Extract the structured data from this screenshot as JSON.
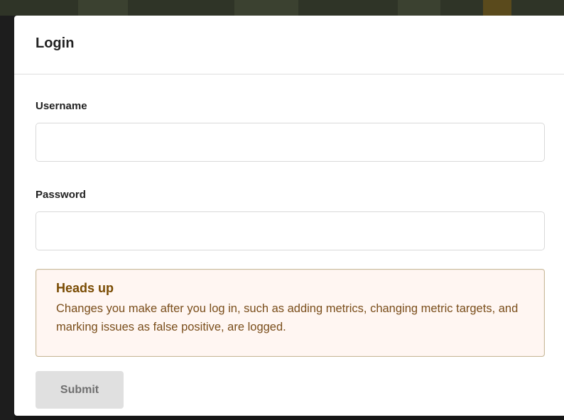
{
  "modal": {
    "title": "Login"
  },
  "form": {
    "username_label": "Username",
    "username_value": "",
    "password_label": "Password",
    "password_value": "",
    "submit_label": "Submit"
  },
  "notice": {
    "title": "Heads up",
    "text": "Changes you make after you log in, such as adding metrics, changing metric targets, and marking issues as false positive, are logged."
  },
  "colors": {
    "notice_background": "#fff6f2",
    "notice_border": "#c9ba9b",
    "notice_title": "#794b02",
    "submit_background": "#e0e0e0"
  }
}
